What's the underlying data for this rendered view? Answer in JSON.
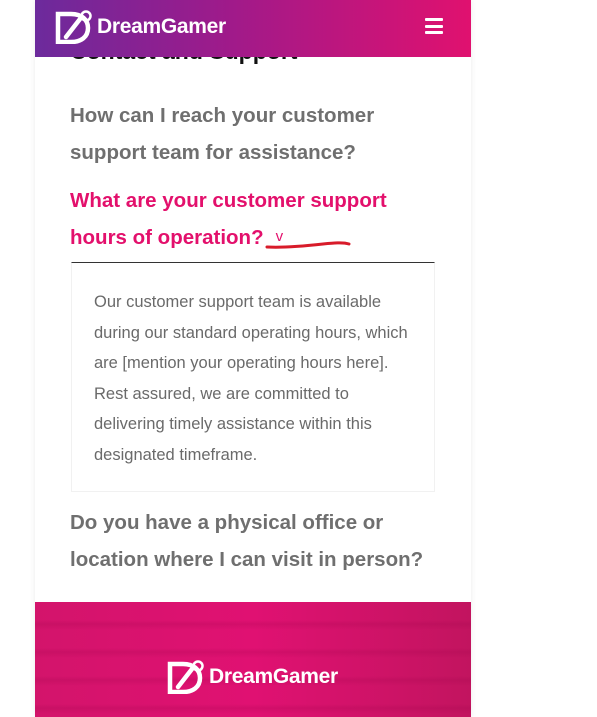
{
  "header": {
    "brand_name": "DreamGamer",
    "logo_icon": "dg-logo-icon",
    "menu_icon": "hamburger-menu-icon"
  },
  "section": {
    "title": "Contact and Support"
  },
  "faq": [
    {
      "question": "How can I reach your customer support team for assistance?",
      "expanded": false
    },
    {
      "question": "What are your customer support hours of operation?",
      "expanded": true,
      "toggle_glyph": "v",
      "answer": "Our customer support team is available during our standard operating hours, which are [mention your operating hours here]. Rest assured, we are committed to delivering timely assistance within this designated timeframe."
    },
    {
      "question": "Do you have a physical office or location where I can visit in person?",
      "expanded": false
    }
  ],
  "footer": {
    "brand_name": "DreamGamer"
  },
  "colors": {
    "accent": "#e3106c",
    "header_gradient_start": "#6c2a9c",
    "header_gradient_end": "#e0116f",
    "question_text": "#6f6f6f",
    "annotation_underline": "#d81b2a"
  }
}
